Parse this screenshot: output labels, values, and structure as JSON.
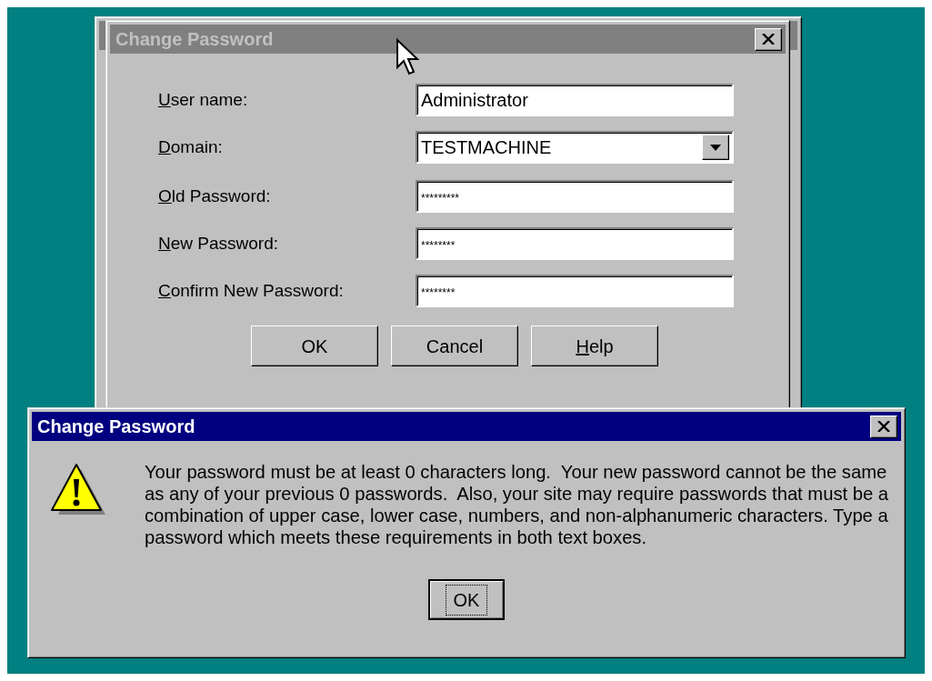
{
  "background_window": {
    "active": false
  },
  "dialog": {
    "title": "Change Password",
    "active": false,
    "field_groups": [
      [
        {
          "kind": "text",
          "label": "User name:",
          "mnemonic": true,
          "value": "Administrator"
        },
        {
          "kind": "dropdown",
          "label": "Domain:",
          "mnemonic": true,
          "value": "TESTMACHINE"
        }
      ],
      [
        {
          "kind": "password",
          "label": "Old Password:",
          "mnemonic": true,
          "value": "*********"
        },
        {
          "kind": "password",
          "label": "New Password:",
          "mnemonic": true,
          "value": "********"
        },
        {
          "kind": "password",
          "label": "Confirm New Password:",
          "mnemonic": true,
          "value": "********"
        }
      ]
    ],
    "buttons": [
      {
        "label": "OK",
        "mnemonic": false,
        "focused": false
      },
      {
        "label": "Cancel",
        "mnemonic": false,
        "focused": false
      },
      {
        "label": "Help",
        "mnemonic": true,
        "focused": false
      }
    ]
  },
  "message_box": {
    "title": "Change Password",
    "active": true,
    "kind": "warning",
    "message": "Your password must be at least 0 characters long.  Your new password cannot be the same as any of your previous 0 passwords.  Also, your site may require passwords that must be a combination of upper case, lower case, numbers, and non-alphanumeric characters. Type a password which meets these requirements in both text boxes.",
    "buttons": [
      {
        "label": "OK",
        "mnemonic": false,
        "focused": true
      }
    ]
  }
}
